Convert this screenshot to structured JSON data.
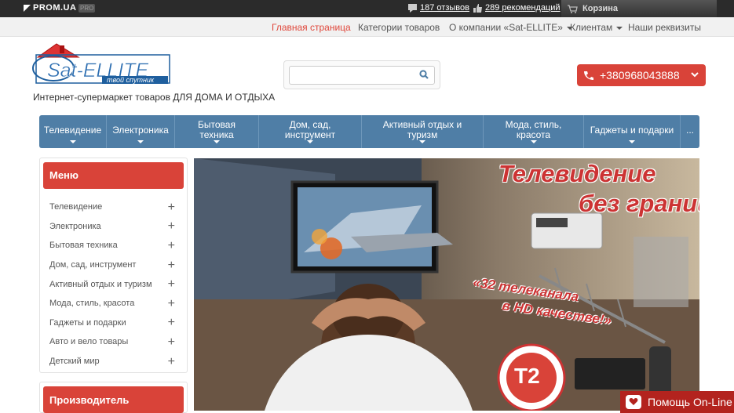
{
  "topbar": {
    "brand": "PROM.UA",
    "badge": "PRO",
    "reviews": "187 отзывов",
    "recommendations": "289 рекомендаций",
    "cart": "Корзина"
  },
  "subnav": {
    "items": [
      {
        "label": "Главная страница",
        "active": true
      },
      {
        "label": "Категории товаров"
      },
      {
        "label": "О компании «Sat-ELLITE»"
      },
      {
        "label": "Клиентам"
      },
      {
        "label": "Наши реквизиты"
      }
    ]
  },
  "header": {
    "logo_text": "Sat-ELLITE",
    "logo_sub": "твой спутник",
    "tagline": "Интернет-супермаркет товаров ДЛЯ ДОМА И ОТДЫХА",
    "search_placeholder": "",
    "phone": "+380968043888"
  },
  "mainnav": {
    "items": [
      {
        "label": "Телевидение"
      },
      {
        "label": "Электроника"
      },
      {
        "label": "Бытовая техника"
      },
      {
        "label": "Дом, сад, инструмент"
      },
      {
        "label": "Активный отдых и туризм"
      },
      {
        "label": "Мода, стиль, красота"
      },
      {
        "label": "Гаджеты и подарки"
      },
      {
        "label": "..."
      }
    ]
  },
  "sidebar": {
    "title": "Меню",
    "items": [
      "Телевидение",
      "Электроника",
      "Бытовая техника",
      "Дом, сад, инструмент",
      "Активный отдых и туризм",
      "Мода, стиль, красота",
      "Гаджеты и подарки",
      "Авто и вело товары",
      "Детский мир"
    ],
    "producer_title": "Производитель"
  },
  "banner": {
    "title_line1": "Телевидение",
    "title_line2": "без границ",
    "channels_line1": "«32 телеканала",
    "channels_line2": "в HD качестве!»",
    "badge": "T2"
  },
  "help": {
    "label": "Помощь On-Line"
  },
  "colors": {
    "accent_red": "#d94339",
    "nav_blue": "#4f7ea6",
    "topbar": "#2b2b2b"
  }
}
